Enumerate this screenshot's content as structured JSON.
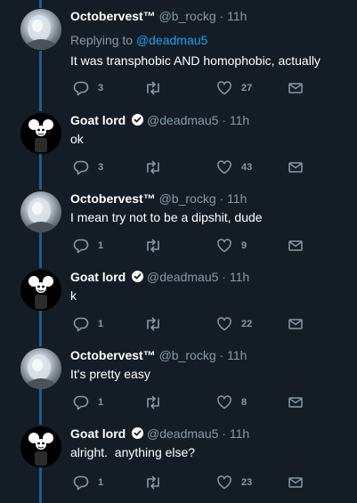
{
  "tweets": [
    {
      "name": "Octobervest™",
      "handle": "@b_rockg",
      "time": "· 11h",
      "reply_prefix": "Replying to",
      "reply_to": "@deadmau5",
      "text": "It was transphobic AND homophobic, actually",
      "replies": "3",
      "retweets": "",
      "likes": "27",
      "avatar": "octobervest-avatar"
    },
    {
      "name": "Goat lord",
      "handle": "@deadmau5",
      "time": "· 11h",
      "verified": true,
      "text": "ok",
      "replies": "3",
      "retweets": "",
      "likes": "43",
      "avatar": "deadmau5-avatar"
    },
    {
      "name": "Octobervest™",
      "handle": "@b_rockg",
      "time": "· 11h",
      "text": "I mean try not to be a dipshit, dude",
      "replies": "1",
      "retweets": "",
      "likes": "9",
      "avatar": "octobervest-avatar"
    },
    {
      "name": "Goat lord",
      "handle": "@deadmau5",
      "time": "· 11h",
      "verified": true,
      "text": "k",
      "replies": "1",
      "retweets": "",
      "likes": "22",
      "avatar": "deadmau5-avatar"
    },
    {
      "name": "Octobervest™",
      "handle": "@b_rockg",
      "time": "· 11h",
      "text": "It's pretty easy",
      "replies": "1",
      "retweets": "",
      "likes": "8",
      "avatar": "octobervest-avatar"
    },
    {
      "name": "Goat lord",
      "handle": "@deadmau5",
      "time": "· 11h",
      "verified": true,
      "text": "alright.  anything else?",
      "replies": "1",
      "retweets": "",
      "likes": "23",
      "avatar": "deadmau5-avatar"
    }
  ],
  "colors": {
    "background": "#141d26",
    "text": "#ffffff",
    "muted": "#8899a6",
    "link": "#1da1f2",
    "thread_line": "#1d5e8c"
  },
  "icons": [
    "reply-icon",
    "retweet-icon",
    "like-icon",
    "dm-icon",
    "verified-badge-icon"
  ]
}
